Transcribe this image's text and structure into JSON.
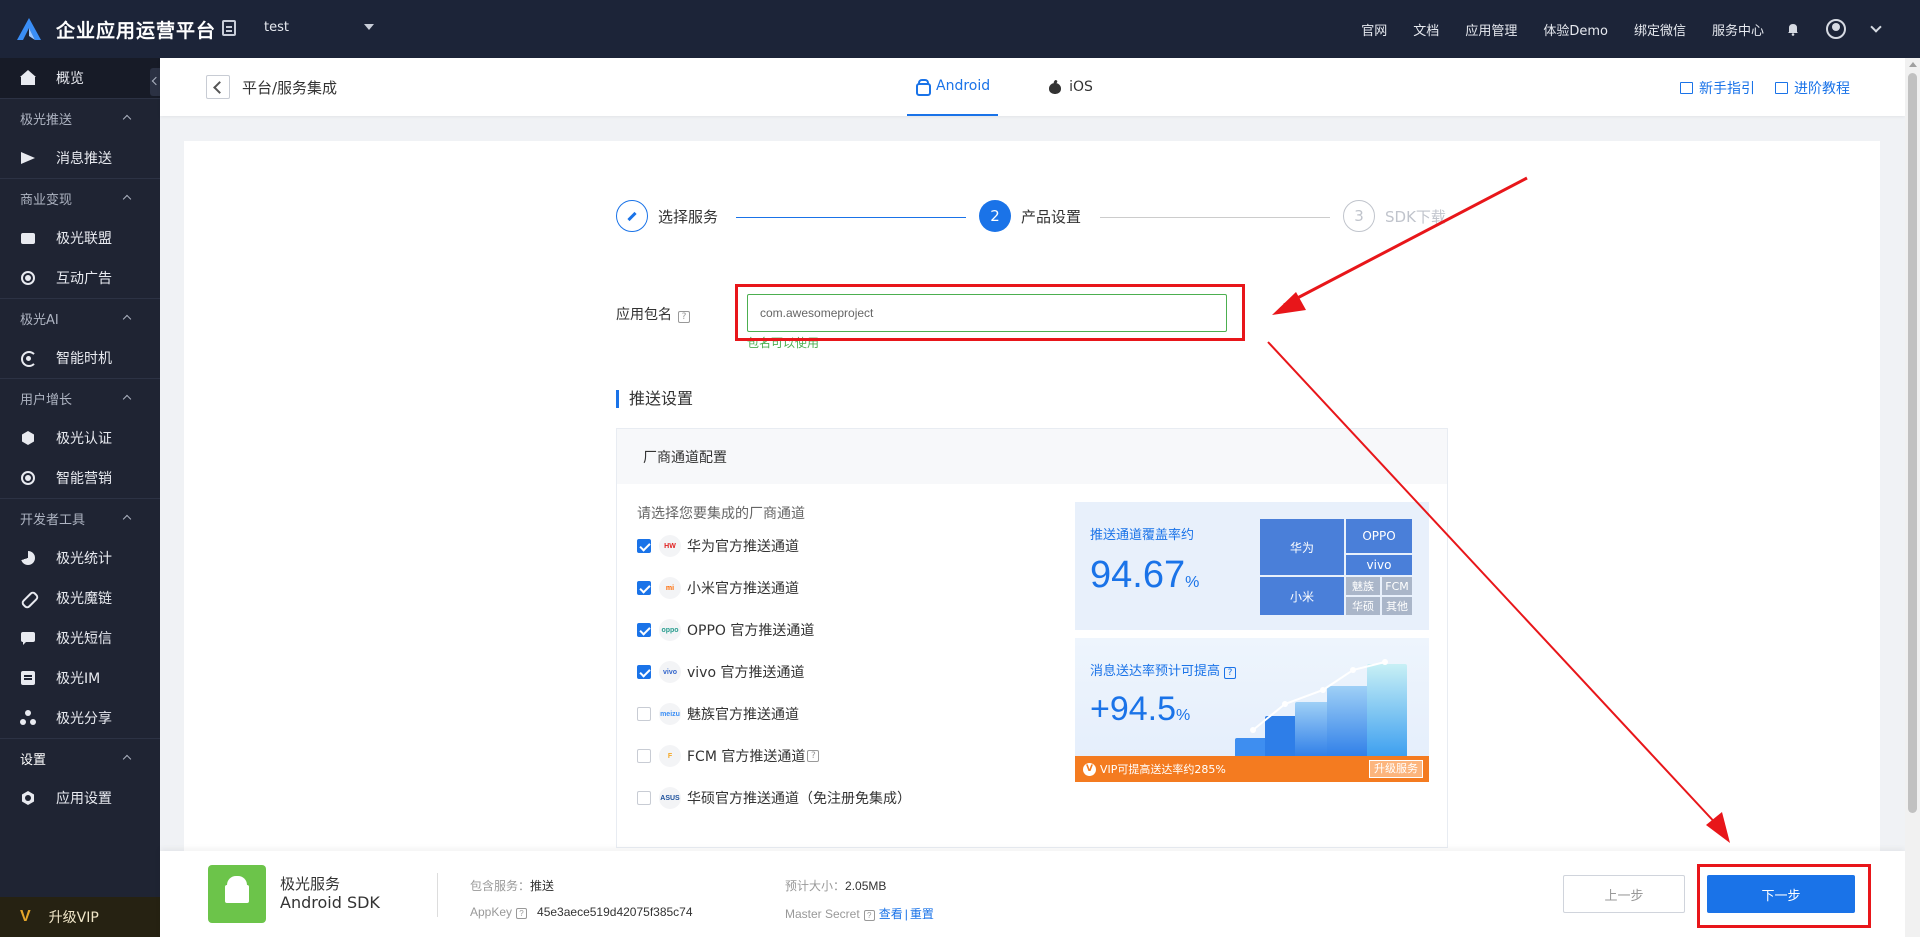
{
  "topbar": {
    "brand": "企业应用运营平台",
    "app_name": "test",
    "nav": [
      "官网",
      "文档",
      "应用管理",
      "体验Demo",
      "绑定微信",
      "服务中心"
    ]
  },
  "sidebar": {
    "overview": "概览",
    "groups": [
      {
        "title": "极光推送",
        "items": [
          "消息推送"
        ]
      },
      {
        "title": "商业变现",
        "items": [
          "极光联盟",
          "互动广告"
        ]
      },
      {
        "title": "极光AI",
        "items": [
          "智能时机"
        ]
      },
      {
        "title": "用户增长",
        "items": [
          "极光认证",
          "智能营销"
        ]
      },
      {
        "title": "开发者工具",
        "items": [
          "极光统计",
          "极光魔链",
          "极光短信",
          "极光IM",
          "极光分享"
        ]
      },
      {
        "title": "设置",
        "items": [
          "应用设置"
        ]
      }
    ],
    "vip_mark": "V",
    "vip_label": "升级VIP"
  },
  "subheader": {
    "breadcrumb": "平台/服务集成",
    "tabs": [
      "Android",
      "iOS"
    ],
    "links": [
      "新手指引",
      "进阶教程"
    ]
  },
  "steps": [
    {
      "num": "",
      "label": "选择服务"
    },
    {
      "num": "2",
      "label": "产品设置"
    },
    {
      "num": "3",
      "label": "SDK下载"
    }
  ],
  "package": {
    "label": "应用包名",
    "q": "?",
    "value": "com.awesomeproject",
    "hint": "包名可以使用"
  },
  "push": {
    "title": "推送设置",
    "vendor_header": "厂商通道配置",
    "prompt": "请选择您要集成的厂商通道",
    "vendors": [
      {
        "logo": "HW",
        "label": "华为官方推送通道",
        "checked": true
      },
      {
        "logo": "mi",
        "label": "小米官方推送通道",
        "checked": true
      },
      {
        "logo": "oppo",
        "label": "OPPO 官方推送通道",
        "checked": true
      },
      {
        "logo": "vivo",
        "label": "vivo 官方推送通道",
        "checked": true
      },
      {
        "logo": "meizu",
        "label": "魅族官方推送通道",
        "checked": false
      },
      {
        "logo": "F",
        "label": "FCM 官方推送通道",
        "checked": false
      },
      {
        "logo": "ASUS",
        "label": "华硕官方推送通道（免注册免集成）",
        "checked": false
      }
    ],
    "coverage_title": "推送通道覆盖率约",
    "coverage_value": "94.67",
    "coverage_unit": "%",
    "treemap": {
      "huawei": "华为",
      "oppo": "OPPO",
      "vivo": "vivo",
      "xiaomi": "小米",
      "meizu": "魅族",
      "fcm": "FCM",
      "asus": "华硕",
      "other": "其他"
    },
    "reach_title": "消息送达率预计可提高",
    "reach_value": "+94.5",
    "reach_unit": "%",
    "vip_badge": "V",
    "vip_text": "VIP可提高送达率约285%",
    "vip_upgrade": "升级服务"
  },
  "bottom": {
    "name1": "极光服务",
    "name2": "Android SDK",
    "services_label": "包含服务：",
    "services_value": "推送",
    "appkey_label": "AppKey",
    "appkey_value": "45e3aece519d42075f385c74",
    "size_label": "预计大小：",
    "size_value": "2.05MB",
    "secret_label": "Master Secret",
    "secret_view": "查看",
    "secret_sep": "|",
    "secret_reset": "重置",
    "prev": "上一步",
    "next": "下一步"
  },
  "colors": {
    "accent": "#1a73e8",
    "annotation": "#e8161a",
    "success": "#4caf50",
    "vip": "#f47b20"
  }
}
